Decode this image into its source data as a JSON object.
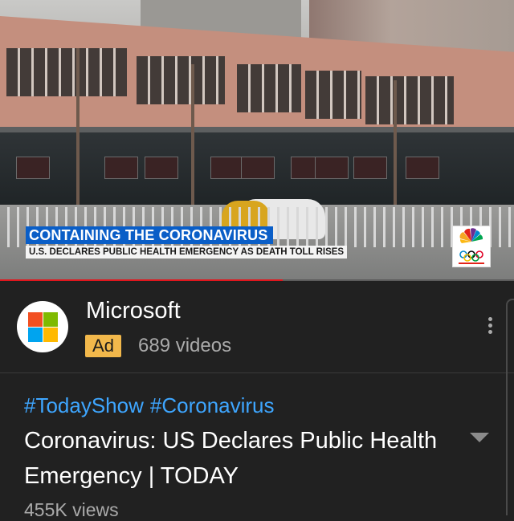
{
  "video": {
    "headline": "CONTAINING THE CORONAVIRUS",
    "subheadline": "U.S. DECLARES PUBLIC HEALTH EMERGENCY AS DEATH TOLL RISES",
    "logo_icon": "nbc-peacock-olympic-rings-icon",
    "progress_fraction": 0.55,
    "progress_color": "#e0161d",
    "headline_color": "#0a5ec7"
  },
  "channel": {
    "name": "Microsoft",
    "ad_badge": "Ad",
    "video_count": "689 videos",
    "avatar_icon": "microsoft-logo-icon",
    "menu_icon": "more-vertical-icon",
    "ad_color": "#f2b84b"
  },
  "details": {
    "hashtags": [
      "#TodayShow",
      "#Coronavirus"
    ],
    "title": "Coronavirus: US Declares Public Health Emergency | TODAY",
    "expand_icon": "chevron-down-icon",
    "views": "455K views",
    "hashtag_color": "#3ea6ff"
  }
}
